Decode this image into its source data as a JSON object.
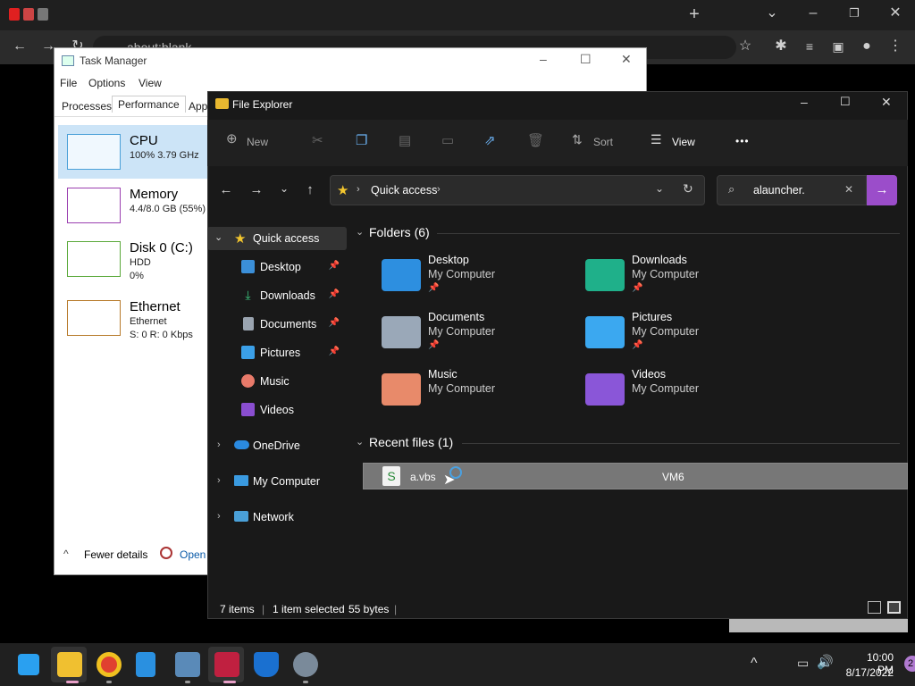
{
  "browser": {
    "address": "about:blank",
    "new_tab": "+"
  },
  "task_manager": {
    "title": "Task Manager",
    "menu": [
      "File",
      "Options",
      "View"
    ],
    "tabs": [
      "Processes",
      "Performance",
      "App"
    ],
    "perf": [
      {
        "name": "CPU",
        "sub1": "100%  3.79 GHz",
        "sub2": ""
      },
      {
        "name": "Memory",
        "sub1": "4.4/8.0 GB (55%)",
        "sub2": ""
      },
      {
        "name": "Disk 0 (C:)",
        "sub1": "HDD",
        "sub2": "0%"
      },
      {
        "name": "Ethernet",
        "sub1": "Ethernet",
        "sub2": "S: 0 R: 0 Kbps"
      }
    ],
    "fewer_details": "Fewer details",
    "open": "Open"
  },
  "explorer": {
    "title": "File Explorer",
    "toolbar": {
      "new": "New",
      "sort": "Sort",
      "view": "View",
      "more": "•••"
    },
    "breadcrumb": "Quick access",
    "search": "alauncher.",
    "tree": {
      "quick_access": "Quick access",
      "items": [
        {
          "label": "Desktop",
          "pin": "📌"
        },
        {
          "label": "Downloads",
          "pin": "📌"
        },
        {
          "label": "Documents",
          "pin": "📌"
        },
        {
          "label": "Pictures",
          "pin": "📌"
        },
        {
          "label": "Music",
          "pin": ""
        },
        {
          "label": "Videos",
          "pin": ""
        }
      ],
      "onedrive": "OneDrive",
      "my_computer": "My Computer",
      "network": "Network"
    },
    "folders_header": "Folders (6)",
    "folders": [
      {
        "name": "Desktop",
        "loc": "My Computer",
        "pin": "📌"
      },
      {
        "name": "Downloads",
        "loc": "My Computer",
        "pin": "📌"
      },
      {
        "name": "Documents",
        "loc": "My Computer",
        "pin": "📌"
      },
      {
        "name": "Pictures",
        "loc": "My Computer",
        "pin": "📌"
      },
      {
        "name": "Music",
        "loc": "My Computer",
        "pin": ""
      },
      {
        "name": "Videos",
        "loc": "My Computer",
        "pin": ""
      }
    ],
    "recent_header": "Recent files (1)",
    "recent": [
      {
        "name": "a.vbs",
        "location": "VM6"
      }
    ],
    "status": {
      "items": "7 items",
      "selected": "1 item selected",
      "size": "55 bytes"
    }
  },
  "taskbar": {
    "time": "10:00 PM",
    "date": "8/17/2022",
    "badge": "2"
  },
  "colors": {
    "accent": "#9b4dca",
    "explorer_bg": "#191919",
    "taskbar": "#202020",
    "selection": "#777777"
  }
}
